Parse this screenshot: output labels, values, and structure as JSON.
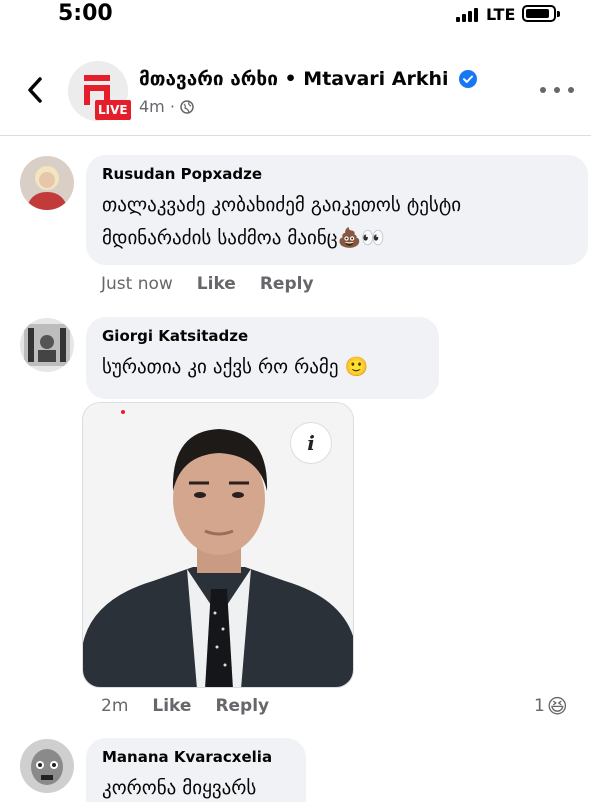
{
  "status_bar": {
    "time": "5:00",
    "network": "LTE",
    "icons": [
      "signal-icon",
      "battery-icon"
    ]
  },
  "header": {
    "page_name": "მთავარი არხი • Mtavari Arkhi",
    "live_badge": "LIVE",
    "post_time": "4m ·",
    "icons": [
      "back-chevron-icon",
      "verified-badge-icon",
      "globe-icon",
      "more-dots-icon"
    ]
  },
  "comments": [
    {
      "author": "Rusudan Popxadze",
      "text_line1": "თალაკვაძე კობახიძემ გაიკეთოს ტესტი",
      "text_line2": "მდინარაძის საძმოა მაინც💩👀",
      "time": "Just now",
      "like_label": "Like",
      "reply_label": "Reply"
    },
    {
      "author": "Giorgi Katsitadze",
      "text": "სურათია კი აქვს რო რამე 🙂",
      "time": "2m",
      "like_label": "Like",
      "reply_label": "Reply",
      "reaction_count": "1",
      "reaction_emoji": "😆",
      "photo_info_glyph": "i"
    },
    {
      "author": "Manana Kvaracxelia",
      "text": "კორონა მიყვარს"
    }
  ],
  "colors": {
    "bubble": "#f0f2f5",
    "secondary_text": "#65676b",
    "verified": "#1877f2",
    "live": "#e41e2b"
  }
}
